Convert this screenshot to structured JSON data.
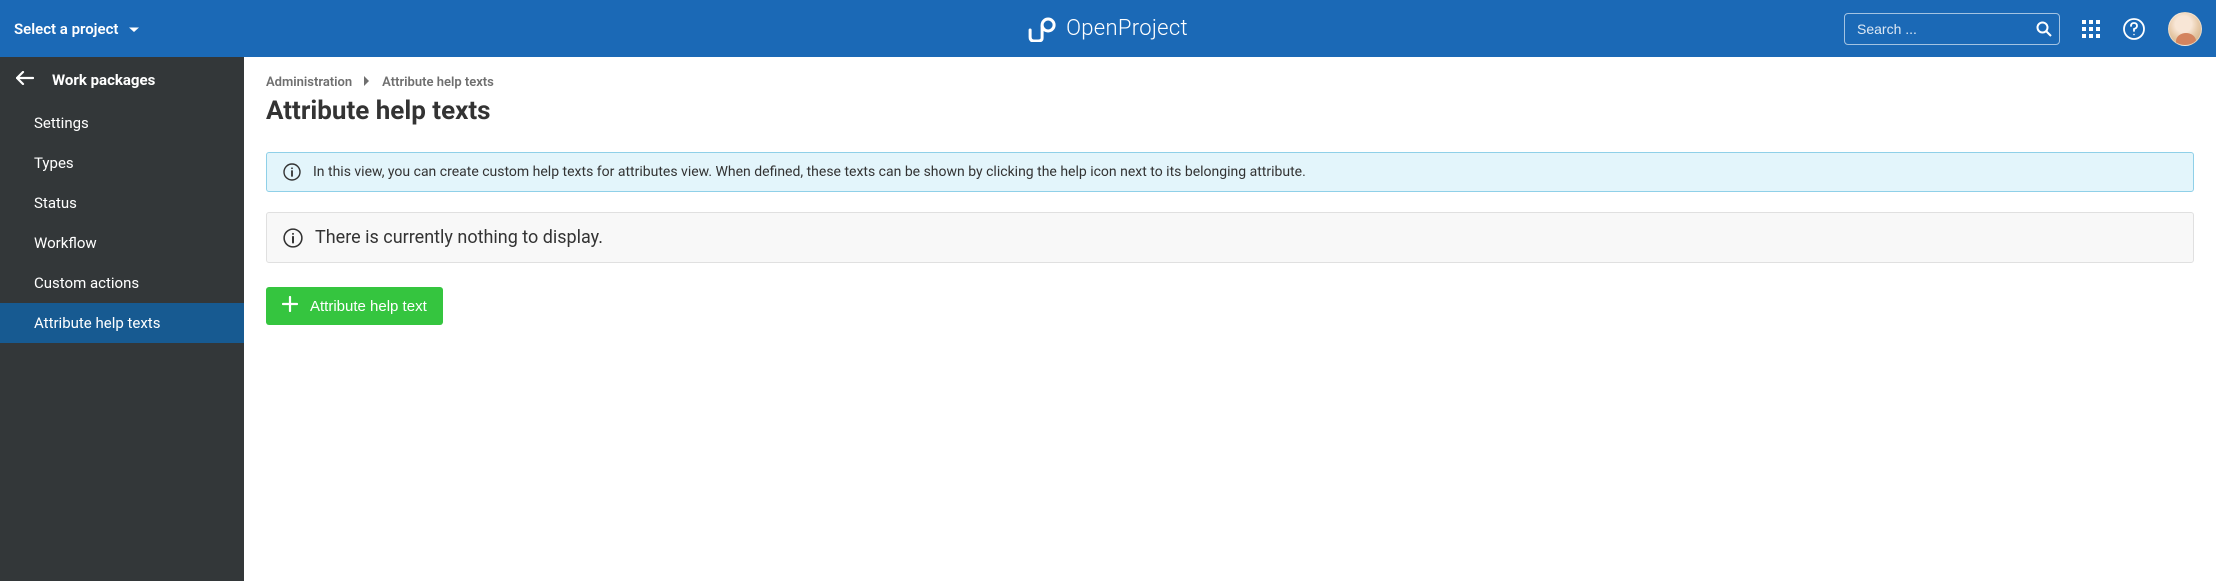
{
  "header": {
    "project_selector_label": "Select a project",
    "logo_text": "OpenProject",
    "search_placeholder": "Search ..."
  },
  "sidebar": {
    "title": "Work packages",
    "items": [
      {
        "label": "Settings",
        "active": false
      },
      {
        "label": "Types",
        "active": false
      },
      {
        "label": "Status",
        "active": false
      },
      {
        "label": "Workflow",
        "active": false
      },
      {
        "label": "Custom actions",
        "active": false
      },
      {
        "label": "Attribute help texts",
        "active": true
      }
    ]
  },
  "breadcrumb": {
    "parent": "Administration",
    "current": "Attribute help texts"
  },
  "page": {
    "title": "Attribute help texts",
    "info_text": "In this view, you can create custom help texts for attributes view. When defined, these texts can be shown by clicking the help icon next to its belonging attribute.",
    "empty_text": "There is currently nothing to display.",
    "add_button_label": "Attribute help text"
  }
}
